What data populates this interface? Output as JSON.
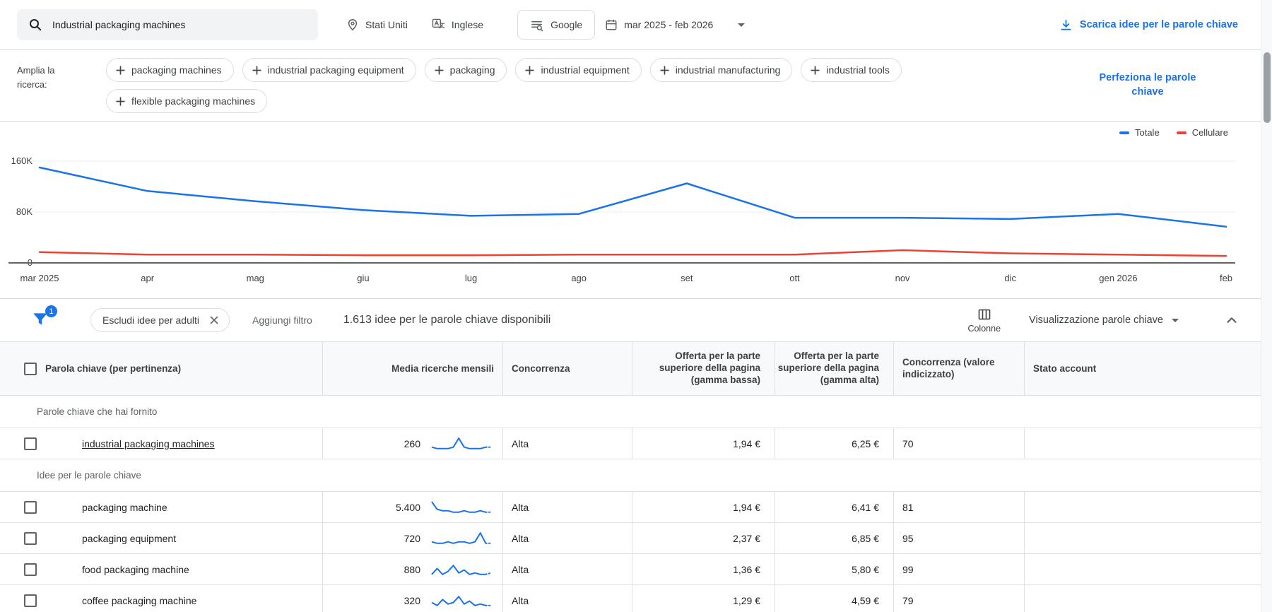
{
  "topbar": {
    "search_value": "Industrial packaging machines",
    "location": "Stati Uniti",
    "language": "Inglese",
    "network": "Google",
    "date_range": "mar 2025 - feb 2026",
    "download_label": "Scarica idee per le parole chiave"
  },
  "broaden": {
    "label": "Amplia la ricerca:",
    "chips": [
      "packaging machines",
      "industrial packaging equipment",
      "packaging",
      "industrial equipment",
      "industrial manufacturing",
      "industrial tools",
      "flexible packaging machines"
    ],
    "refine_label": "Perfeziona le parole chiave"
  },
  "chart_data": {
    "type": "line",
    "x": [
      "mar 2025",
      "apr",
      "mag",
      "giu",
      "lug",
      "ago",
      "set",
      "ott",
      "nov",
      "dic",
      "gen 2026",
      "feb"
    ],
    "series": [
      {
        "name": "Totale",
        "color": "#1a73e8",
        "values": [
          150000,
          113000,
          97000,
          83000,
          74000,
          77000,
          125000,
          71000,
          71000,
          69000,
          77000,
          57000
        ]
      },
      {
        "name": "Cellulare",
        "color": "#ea4335",
        "values": [
          17000,
          13000,
          13000,
          12000,
          12000,
          13000,
          13000,
          13000,
          20000,
          15000,
          13000,
          11000
        ]
      }
    ],
    "y_ticks": [
      {
        "label": "160K",
        "value": 160000
      },
      {
        "label": "80K",
        "value": 80000
      },
      {
        "label": "0",
        "value": 0
      }
    ],
    "ylim": [
      0,
      180000
    ],
    "grid": true,
    "legend_position": "top-right"
  },
  "filterbar": {
    "badge": "1",
    "exclude_chip": "Escludi idee per adulti",
    "add_filter": "Aggiungi filtro",
    "ideas_count": "1.613 idee per le parole chiave disponibili",
    "columns_label": "Colonne",
    "view_label": "Visualizzazione parole chiave"
  },
  "table": {
    "headers": {
      "keyword": "Parola chiave (per pertinenza)",
      "searches": "Media ricerche mensili",
      "competition": "Concorrenza",
      "bid_low": "Offerta per la parte superiore della pagina (gamma bassa)",
      "bid_high": "Offerta per la parte superiore della pagina (gamma alta)",
      "competition_index": "Concorrenza (valore indicizzato)",
      "account_status": "Stato account"
    },
    "groups": [
      {
        "section": "Parole chiave che hai fornito",
        "rows": [
          {
            "keyword": "industrial packaging machines",
            "searches": "260",
            "competition": "Alta",
            "bid_low": "1,94 €",
            "bid_high": "6,25 €",
            "index": "70",
            "spark": [
              3,
              2,
              2,
              2,
              3,
              9,
              3,
              2,
              2,
              2,
              3,
              3
            ]
          }
        ]
      },
      {
        "section": "Idee per le parole chiave",
        "rows": [
          {
            "keyword": "packaging machine",
            "searches": "5.400",
            "competition": "Alta",
            "bid_low": "1,94 €",
            "bid_high": "6,41 €",
            "index": "81",
            "spark": [
              9,
              4,
              3,
              3,
              2,
              2,
              3,
              2,
              2,
              3,
              2,
              2
            ]
          },
          {
            "keyword": "packaging equipment",
            "searches": "720",
            "competition": "Alta",
            "bid_low": "2,37 €",
            "bid_high": "6,85 €",
            "index": "95",
            "spark": [
              3,
              2,
              2,
              3,
              2,
              3,
              3,
              2,
              3,
              9,
              2,
              2
            ]
          },
          {
            "keyword": "food packaging machine",
            "searches": "880",
            "competition": "Alta",
            "bid_low": "1,36 €",
            "bid_high": "5,80 €",
            "index": "99",
            "spark": [
              2,
              6,
              2,
              4,
              8,
              3,
              5,
              2,
              3,
              2,
              2,
              3
            ]
          },
          {
            "keyword": "coffee packaging machine",
            "searches": "320",
            "competition": "Alta",
            "bid_low": "1,29 €",
            "bid_high": "4,59 €",
            "index": "79",
            "spark": [
              4,
              2,
              6,
              3,
              4,
              8,
              3,
              5,
              2,
              3,
              2,
              2
            ]
          }
        ]
      }
    ]
  }
}
